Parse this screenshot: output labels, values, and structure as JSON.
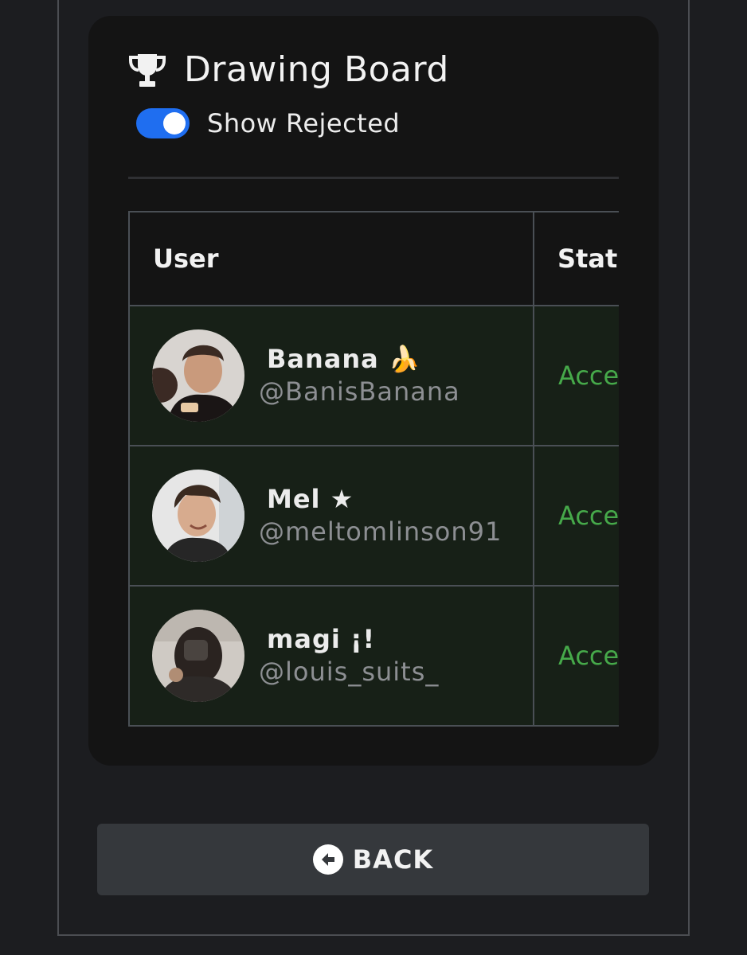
{
  "header": {
    "icon": "trophy-icon",
    "title": "Drawing Board"
  },
  "filter": {
    "toggle_label": "Show Rejected",
    "toggle_on": true,
    "accent": "#1f6ef0"
  },
  "table": {
    "columns": [
      "User",
      "Stat"
    ],
    "rows": [
      {
        "display_name": "Banana 🍌",
        "handle": "@BanisBanana",
        "status": "Acce"
      },
      {
        "display_name": "Mel ★",
        "handle": "@meltomlinson91",
        "status": "Acce"
      },
      {
        "display_name": "magi ¡!",
        "handle": "@louis_suits_",
        "status": "Acce"
      }
    ],
    "status_color": "#46a94a"
  },
  "back_button": {
    "icon": "arrow-left-circle-icon",
    "label": "BACK"
  }
}
